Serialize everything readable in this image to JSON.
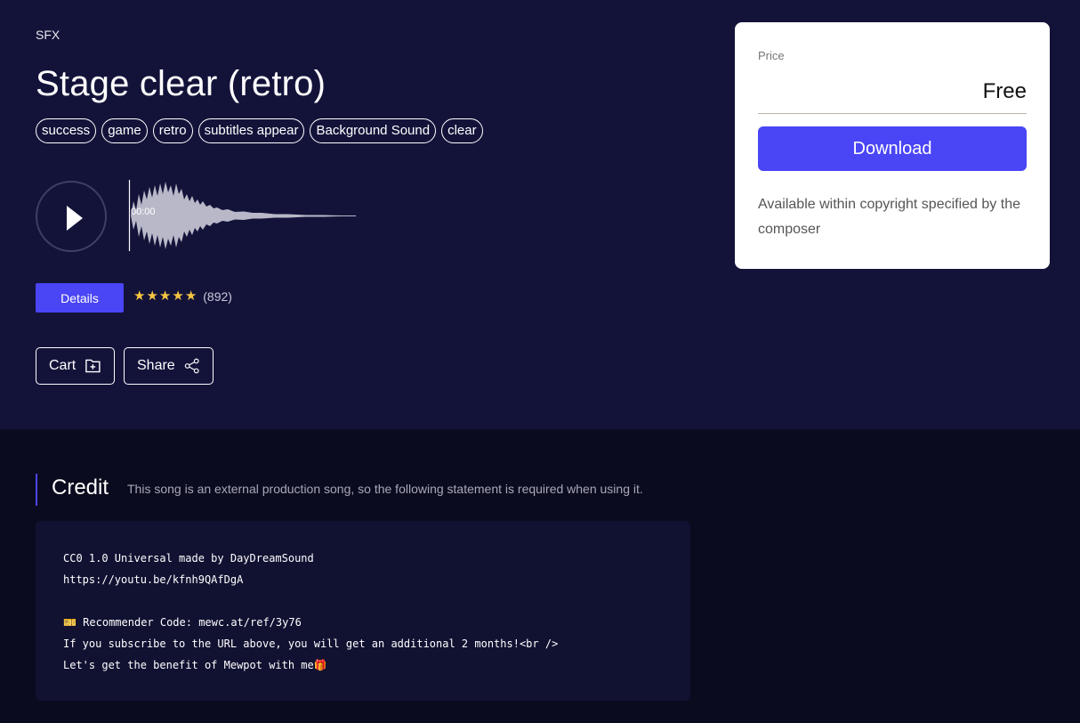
{
  "category": "SFX",
  "title": "Stage clear (retro)",
  "tags": [
    "success",
    "game",
    "retro",
    "subtitles appear",
    "Background Sound",
    "clear"
  ],
  "player": {
    "time": "00:00",
    "icon": "play-icon"
  },
  "details_label": "Details",
  "rating": {
    "stars": 5,
    "count": "(892)"
  },
  "actions": {
    "cart_label": "Cart",
    "share_label": "Share"
  },
  "price_card": {
    "label": "Price",
    "value": "Free",
    "download_label": "Download",
    "note": "Available within copyright specified by the composer"
  },
  "credit": {
    "title": "Credit",
    "subtitle": "This song is an external production song, so the following statement is required when using it.",
    "lines": [
      "CC0 1.0 Universal made by DayDreamSound",
      "https://youtu.be/kfnh9QAfDgA",
      "",
      "🎫 Recommender Code: mewc.at/ref/3y76",
      "If you subscribe to the URL above, you will get an additional 2 months!<br />",
      "Let's get the benefit of Mewpot with me🎁"
    ]
  },
  "colors": {
    "accent": "#4a45f5",
    "hero_bg": "#13133a",
    "page_bg": "#0b0b1f",
    "star": "#f5c542"
  }
}
